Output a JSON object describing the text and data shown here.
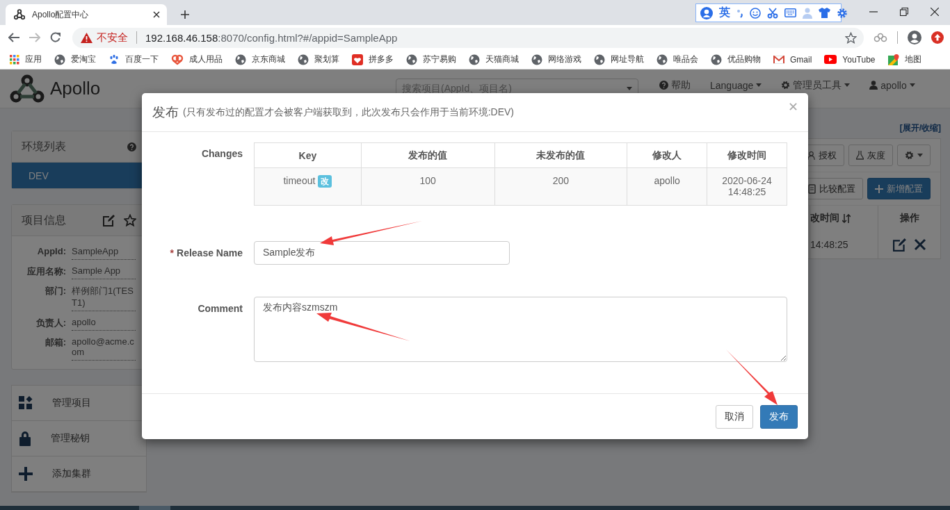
{
  "browser": {
    "tab": {
      "title": "Apollo配置中心"
    },
    "ime": {
      "label": "英"
    },
    "address": {
      "security": "不安全",
      "host": "192.168.46.158",
      "path": ":8070/config.html?#/appid=SampleApp"
    },
    "bookmarks": [
      {
        "kind": "apps",
        "label": "应用"
      },
      {
        "kind": "globe",
        "label": "爱淘宝"
      },
      {
        "kind": "paw",
        "label": "百度一下"
      },
      {
        "kind": "heart",
        "label": "成人用品"
      },
      {
        "kind": "globe",
        "label": "京东商城"
      },
      {
        "kind": "globe",
        "label": "聚划算"
      },
      {
        "kind": "tile",
        "label": "拼多多"
      },
      {
        "kind": "globe",
        "label": "苏宁易购"
      },
      {
        "kind": "globe",
        "label": "天猫商城"
      },
      {
        "kind": "globe",
        "label": "网络游戏"
      },
      {
        "kind": "globe",
        "label": "网址导航"
      },
      {
        "kind": "globe",
        "label": "唯品会"
      },
      {
        "kind": "globe",
        "label": "优品购物"
      },
      {
        "kind": "mail",
        "label": "Gmail"
      },
      {
        "kind": "play",
        "label": "YouTube"
      },
      {
        "kind": "map",
        "label": "地图"
      }
    ]
  },
  "navbar": {
    "logo": "Apollo",
    "search_placeholder": "搜索项目(AppId、项目名)",
    "menus": [
      {
        "kind": "help",
        "label": "帮助"
      },
      {
        "kind": "dropdown",
        "label": "Language"
      },
      {
        "kind": "gear",
        "label": "管理员工具"
      },
      {
        "kind": "user",
        "label": "apollo"
      }
    ]
  },
  "sidebar": {
    "env_title": "环境列表",
    "envs": [
      {
        "label": "DEV",
        "selected": true
      }
    ],
    "info_title": "项目信息",
    "info": [
      {
        "label": "AppId:",
        "value": "SampleApp"
      },
      {
        "label": "应用名称:",
        "value": "Sample App"
      },
      {
        "label": "部门:",
        "value": "样例部门1(TEST1)"
      },
      {
        "label": "负责人:",
        "value": "apollo"
      },
      {
        "label": "邮箱:",
        "value": "apollo@acme.com"
      }
    ],
    "nav": [
      {
        "kind": "grid",
        "label": "管理项目"
      },
      {
        "kind": "lock",
        "label": "管理秘钥"
      },
      {
        "kind": "plus",
        "label": "添加集群"
      }
    ]
  },
  "content": {
    "toggle": "[展开/收缩]",
    "tools": [
      {
        "kind": "grant",
        "label": "授权"
      },
      {
        "kind": "flask",
        "label": "灰度"
      }
    ],
    "actions": [
      {
        "kind": "compare",
        "label": "比较配置"
      },
      {
        "kind": "add",
        "label": "新增配置"
      }
    ],
    "columns": [
      "改时间",
      "操作"
    ],
    "row_time": "14:48:25"
  },
  "modal": {
    "title": "发布",
    "subtitle": "(只有发布过的配置才会被客户端获取到，此次发布只会作用于当前环境:DEV)",
    "changes_label": "Changes",
    "columns": [
      "Key",
      "发布的值",
      "未发布的值",
      "修改人",
      "修改时间"
    ],
    "rows": [
      {
        "key": "timeout",
        "badge": "改",
        "published": "100",
        "unpublished": "200",
        "modifier": "apollo",
        "modified_time": "2020-06-24 14:48:25"
      }
    ],
    "release_name": {
      "required_mark": "*",
      "label": "Release Name",
      "value": "Sample发布"
    },
    "comment": {
      "label": "Comment",
      "value": "发布内容szmszm"
    },
    "buttons": [
      {
        "kind": "default",
        "label": "取消"
      },
      {
        "kind": "primary",
        "label": "发布"
      }
    ]
  }
}
